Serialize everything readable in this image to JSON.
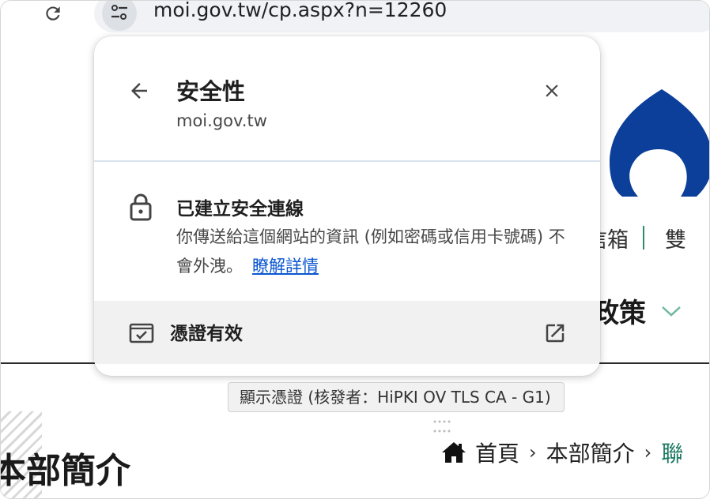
{
  "toolbar": {
    "reload_icon": "reload-icon",
    "site_info_icon": "tune-icon",
    "url": "moi.gov.tw/cp.aspx?n=12260"
  },
  "page": {
    "nav_fragment_1": "信箱",
    "nav_fragment_2": "雙",
    "policy_fragment": "政策",
    "heading_fragment": "本部簡介",
    "breadcrumb": {
      "home": "首頁",
      "about": "本部簡介",
      "next_fragment": "聯"
    },
    "accent_color": "#1f7a63",
    "emblem_color": "#0b3f9a"
  },
  "popup": {
    "title": "安全性",
    "domain": "moi.gov.tw",
    "connection_title": "已建立安全連線",
    "connection_desc": "你傳送給這個網站的資訊 (例如密碼或信用卡號碼) 不會外洩。",
    "learn_more": "瞭解詳情",
    "certificate_label": "憑證有效",
    "link_color": "#0b57d0"
  },
  "tooltip": {
    "text": "顯示憑證 (核發者：HiPKI OV TLS CA - G1)"
  }
}
